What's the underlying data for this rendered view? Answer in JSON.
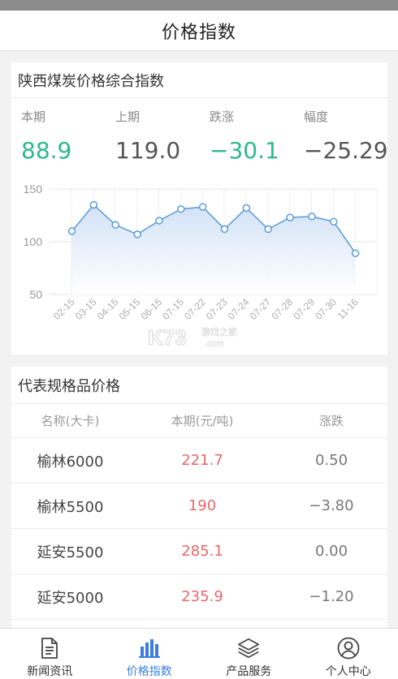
{
  "header": {
    "title": "价格指数"
  },
  "index_card": {
    "title": "陕西煤炭价格综合指数",
    "stats": [
      {
        "label": "本期",
        "value": "88.9"
      },
      {
        "label": "上期",
        "value": "119.0"
      },
      {
        "label": "跌涨",
        "value": "−30.1"
      },
      {
        "label": "幅度",
        "value": "−25.29"
      }
    ],
    "colors": {
      "current": "#2db98a",
      "change": "#2db98a",
      "line": "#5a9bd8"
    }
  },
  "chart_data": {
    "type": "area",
    "categories": [
      "02-15",
      "03-15",
      "04-15",
      "05-15",
      "06-15",
      "07-15",
      "07-22",
      "07-23",
      "07-24",
      "07-27",
      "07-28",
      "07-29",
      "07-30",
      "11-16"
    ],
    "values": [
      110,
      135,
      116,
      107,
      120,
      131,
      133,
      112,
      132,
      112,
      123,
      124,
      119,
      89
    ],
    "yticks": [
      50,
      100,
      150
    ],
    "ylim": [
      50,
      150
    ]
  },
  "price_card": {
    "title": "代表规格品价格",
    "columns": [
      "名称(大卡)",
      "本期(元/吨)",
      "涨跌"
    ],
    "rows": [
      {
        "name": "榆林6000",
        "price": "221.7",
        "change": "0.50"
      },
      {
        "name": "榆林5500",
        "price": "190",
        "change": "−3.80"
      },
      {
        "name": "延安5500",
        "price": "285.1",
        "change": "0.00"
      },
      {
        "name": "延安5000",
        "price": "235.9",
        "change": "−1.20"
      }
    ]
  },
  "tabbar": {
    "tabs": [
      {
        "label": "新闻资讯",
        "icon": "news-document-icon"
      },
      {
        "label": "价格指数",
        "icon": "bar-chart-icon",
        "active": true
      },
      {
        "label": "产品服务",
        "icon": "layers-icon"
      },
      {
        "label": "个人中心",
        "icon": "user-circle-icon"
      }
    ],
    "active_color": "#3a7fe0"
  },
  "watermark": {
    "text": "K73 游戏之家 .com"
  }
}
